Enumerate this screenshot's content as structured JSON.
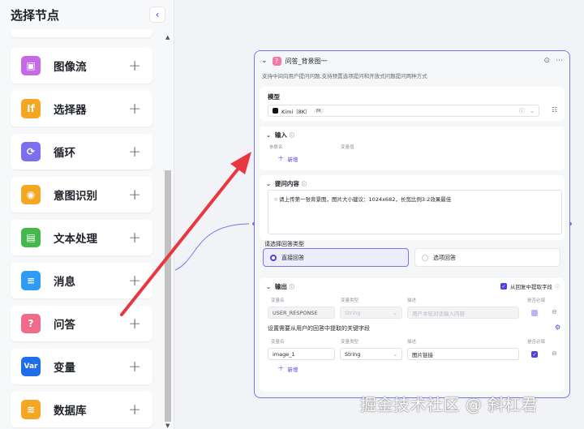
{
  "sidebar": {
    "title": "选择节点",
    "collapse_icon": "‹",
    "items": [
      {
        "label": "图像流",
        "icon": "image-flow-icon",
        "color": "#c668e8",
        "glyph": "▣"
      },
      {
        "label": "选择器",
        "icon": "selector-icon",
        "color": "#f5a623",
        "glyph": "If"
      },
      {
        "label": "循环",
        "icon": "loop-icon",
        "color": "#7b6ff0",
        "glyph": "⟳"
      },
      {
        "label": "意图识别",
        "icon": "intent-icon",
        "color": "#f5a623",
        "glyph": "◉"
      },
      {
        "label": "文本处理",
        "icon": "text-process-icon",
        "color": "#44b84a",
        "glyph": "▤"
      },
      {
        "label": "消息",
        "icon": "message-icon",
        "color": "#2f9bf4",
        "glyph": "≡"
      },
      {
        "label": "问答",
        "icon": "qa-icon",
        "color": "#f06a8a",
        "glyph": "?"
      },
      {
        "label": "变量",
        "icon": "variable-icon",
        "color": "#1f6de8",
        "glyph": "Var"
      },
      {
        "label": "数据库",
        "icon": "database-icon",
        "color": "#f5a623",
        "glyph": "≋"
      }
    ],
    "add_label": "+"
  },
  "card": {
    "title": "问答_背景图一",
    "description": "支持中间向用户提问问题,支持预置选项提问和开放式问题提问两种方式",
    "model": {
      "section_title": "模型",
      "name": "Kimi（8K）",
      "badge": "8K"
    },
    "input": {
      "section_title": "输入",
      "col_param": "参数名",
      "col_value": "变量值",
      "add_label": "新增"
    },
    "prompt": {
      "section_title": "提问内容",
      "text": "请上传第一张背景图，图片大小建议：1024x682，长宽比例3:2效果最佳"
    },
    "answer_type": {
      "label": "请选择回答类型",
      "options": [
        {
          "label": "直接回答",
          "selected": true
        },
        {
          "label": "选项回答",
          "selected": false
        }
      ]
    },
    "output": {
      "section_title": "输出",
      "extract_label": "从回复中提取字段",
      "col_name": "变量名",
      "col_type": "变量类型",
      "col_desc": "描述",
      "col_required": "是否必填",
      "row1": {
        "name": "USER_RESPONSE",
        "type": "String",
        "desc": "用户本轮对话输入内容"
      },
      "hint": "设置需要从用户的回答中提取的关键字段",
      "row2": {
        "name": "image_1",
        "type": "String",
        "desc": "图片链接"
      },
      "add_label": "新增"
    }
  },
  "watermark": "掘金技术社区 @ 斜杠君",
  "colors": {
    "accent": "#4e40e5",
    "arrow": "#e8373f",
    "card_border": "#7b74f0"
  }
}
